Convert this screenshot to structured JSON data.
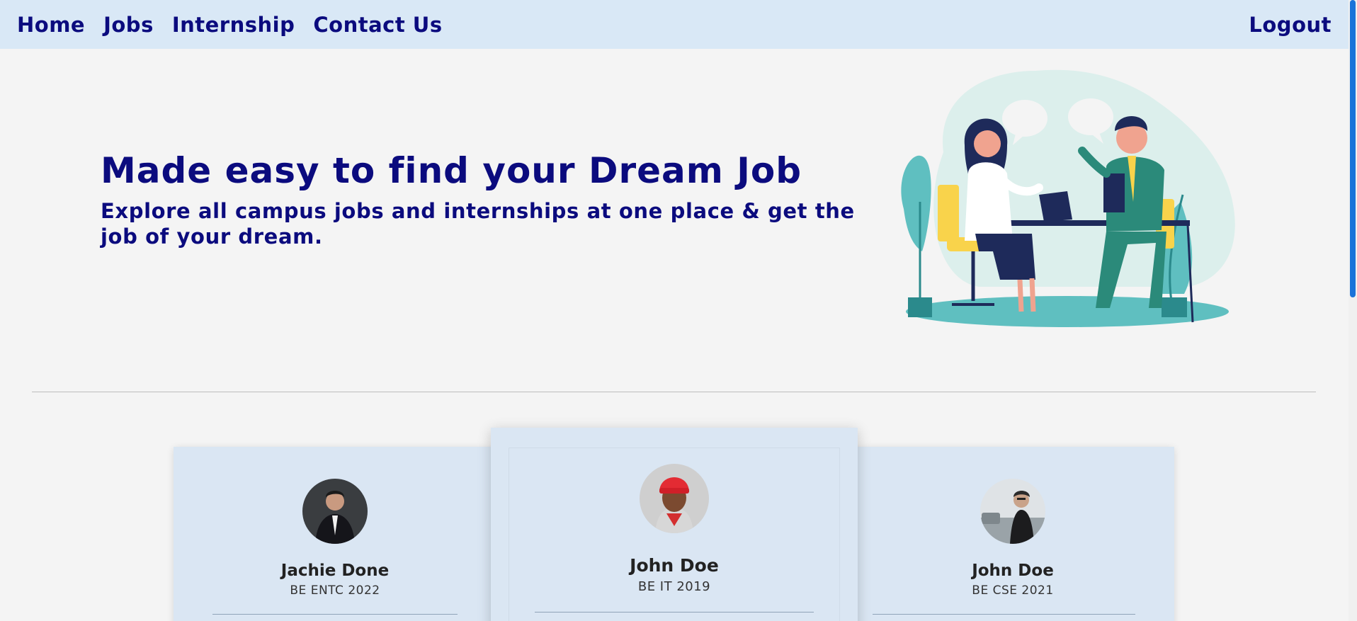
{
  "nav": {
    "links": [
      "Home",
      "Jobs",
      "Internship",
      "Contact Us"
    ],
    "logout": "Logout"
  },
  "hero": {
    "title": "Made easy to find your Dream Job",
    "subtitle": "Explore all campus jobs and internships at one place & get the job of your dream."
  },
  "cards": [
    {
      "name": "Jachie Done",
      "degree": "BE ENTC 2022"
    },
    {
      "name": "John Doe",
      "degree": "BE IT 2019"
    },
    {
      "name": "John Doe",
      "degree": "BE CSE 2021"
    }
  ],
  "colors": {
    "accent": "#0b0b7e",
    "navbar": "#d9e8f6",
    "card": "#dae6f3",
    "background": "#f4f4f4"
  }
}
